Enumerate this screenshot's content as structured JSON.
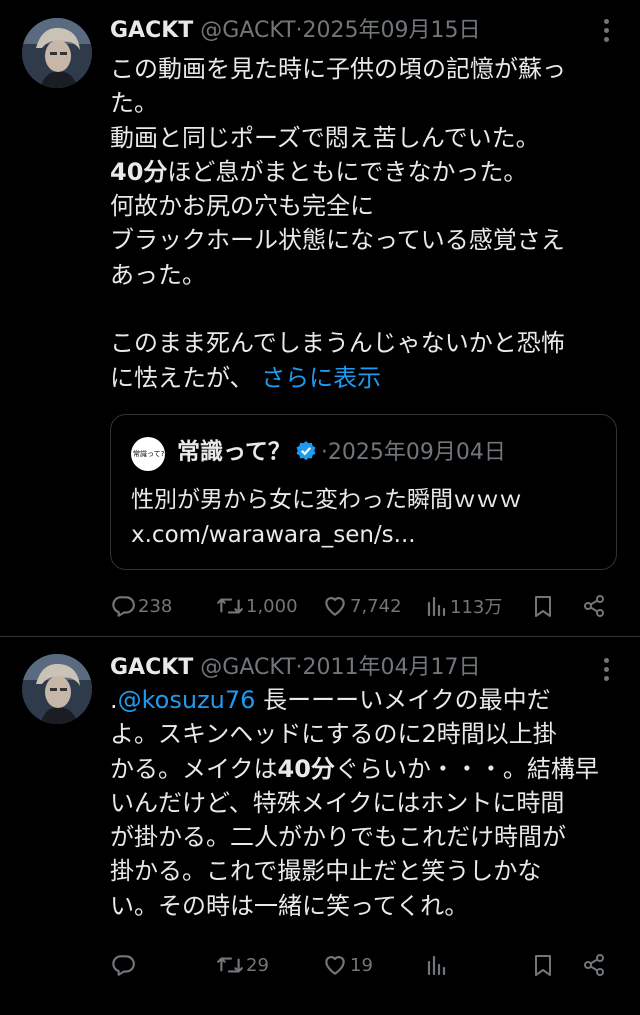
{
  "tweets": [
    {
      "name": "GACKT",
      "handle": "@GACKT",
      "sep": "·",
      "date": "2025年09月15日",
      "lines": [
        "この動画を見た時に子供の頃の記憶が蘇っ",
        "た。",
        "動画と同じポーズで悶え苦しんでいた。",
        "ほど息がまともにできなかった。",
        "何故かお尻の穴も完全に",
        "ブラックホール状態になっている感覚さえ",
        "あった。",
        "",
        "このまま死んでしまうんじゃないかと恐怖",
        "に怯えたが、"
      ],
      "bold_40": "40分",
      "show_more": "さらに表示",
      "quote": {
        "avatar_text": "常識って?",
        "name": "常識って？",
        "sep": "·",
        "date": "2025年09月04日",
        "lines": [
          "性別が男から女に変わった瞬間ｗｗｗ",
          "x.com/warawara_sen/s..."
        ]
      },
      "actions": {
        "replies": "238",
        "retweets": "1,000",
        "likes": "7,742",
        "views": "113万"
      }
    },
    {
      "name": "GACKT",
      "handle": "@GACKT",
      "sep": "·",
      "date": "2011年04月17日",
      "mention_prefix": ".",
      "mention": "@kosuzu76",
      "line1_rest": " 長ーーーいメイクの最中だ",
      "line2": "よ。スキンヘッドにするのに2時間以上掛",
      "line3_pre": "かる。メイクは",
      "bold_40": "40分",
      "line3_post": "ぐらいか・・・。結構早",
      "line4": "いんだけど、特殊メイクにはホントに時間",
      "line5": "が掛かる。二人がかりでもこれだけ時間が",
      "line6": "掛かる。これで撮影中止だと笑うしかな",
      "line7": "い。その時は一緒に笑ってくれ。",
      "actions": {
        "replies": "",
        "retweets": "29",
        "likes": "19",
        "views": ""
      }
    }
  ],
  "icons": {
    "reply": "reply-icon",
    "retweet": "retweet-icon",
    "like": "like-icon",
    "views": "views-icon",
    "bookmark": "bookmark-icon",
    "share": "share-icon",
    "more": "more-icon",
    "verified": "verified-badge-icon"
  },
  "colors": {
    "background": "#000000",
    "text": "#e7e9ea",
    "muted": "#71767b",
    "link": "#1d9bf0",
    "border": "#2f3336"
  }
}
